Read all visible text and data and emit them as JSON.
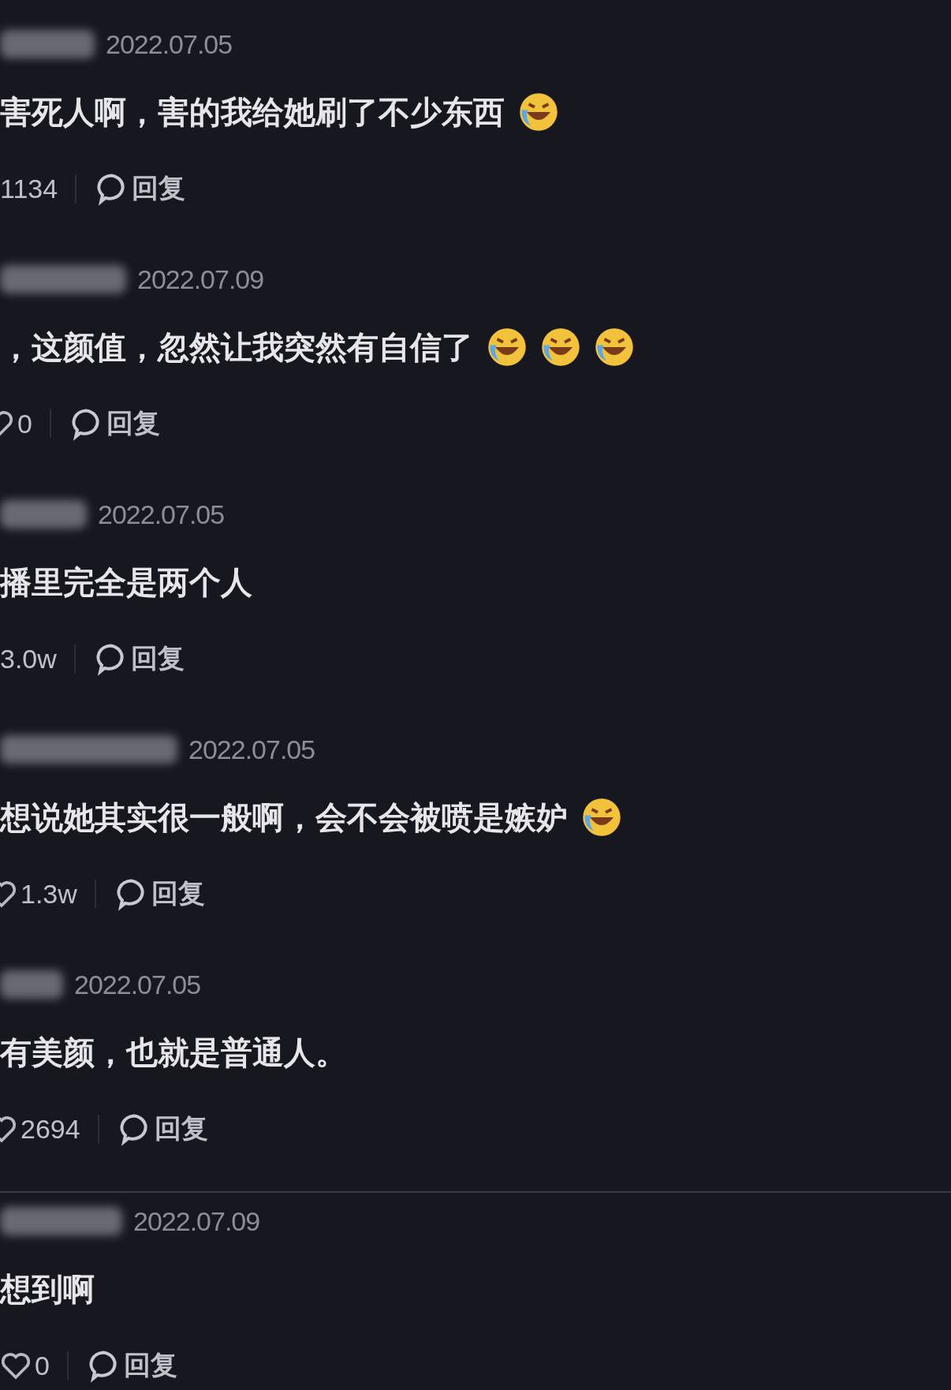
{
  "comments": [
    {
      "date": "2022.07.05",
      "text": "害死人啊，害的我给她刷了不少东西",
      "emojis": [
        {
          "kind": "laughing"
        }
      ],
      "likes": "1134",
      "reply": "回复",
      "divider_above": false
    },
    {
      "date": "2022.07.09",
      "text": "，这颜值，忽然让我突然有自信了",
      "emojis": [
        {
          "kind": "laughing"
        },
        {
          "kind": "laughing"
        },
        {
          "kind": "laughing"
        }
      ],
      "likes": "0",
      "reply": "回复",
      "divider_above": false
    },
    {
      "date": "2022.07.05",
      "text": "播里完全是两个人",
      "likes": "3.0w",
      "reply": "回复",
      "divider_above": false
    },
    {
      "date": "2022.07.05",
      "text": "想说她其实很一般啊，会不会被喷是嫉妒",
      "emojis": [
        {
          "kind": "laughing"
        }
      ],
      "likes": "1.3w",
      "reply": "回复",
      "divider_above": false
    },
    {
      "date": "2022.07.05",
      "text": "有美颜，也就是普通人。",
      "likes": "2694",
      "reply": "回复",
      "divider_above": false
    },
    {
      "date": "2022.07.09",
      "text": "想到啊",
      "likes": "0",
      "reply": "回复",
      "divider_above": true
    }
  ]
}
